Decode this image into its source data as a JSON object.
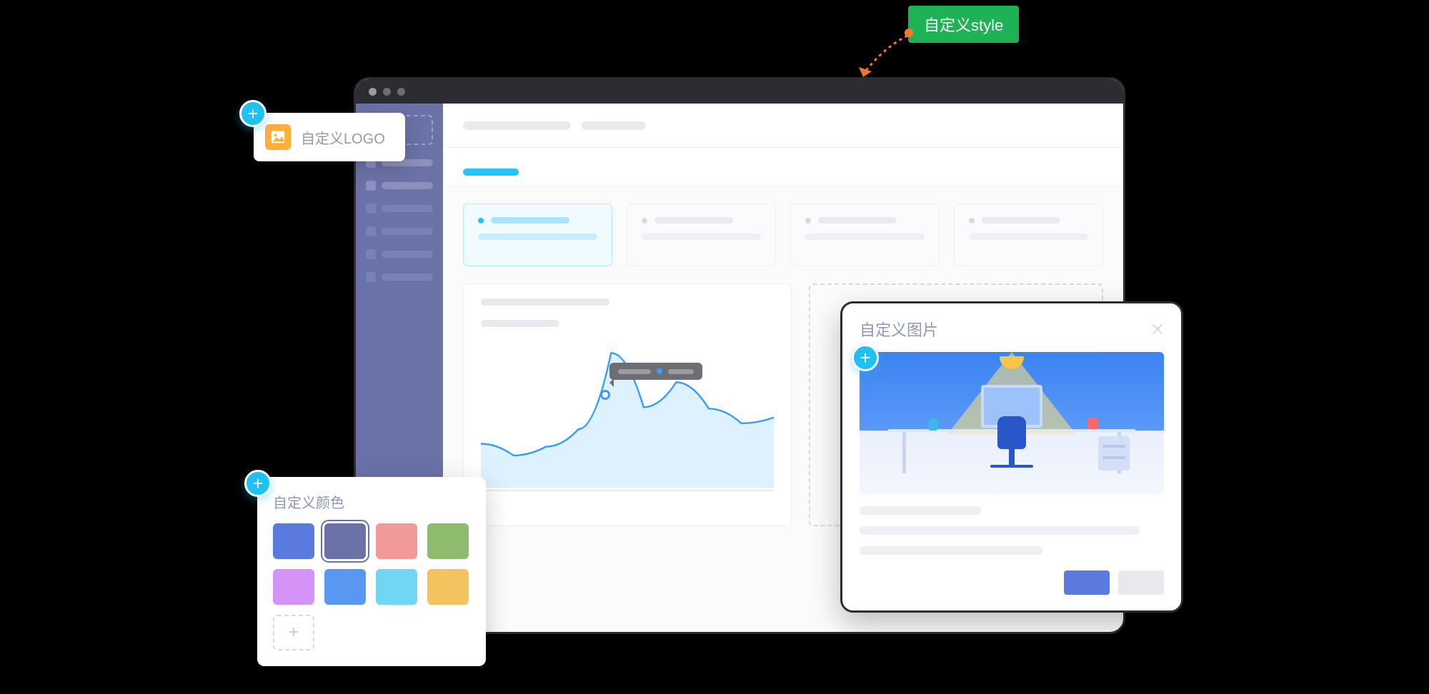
{
  "callouts": {
    "style_label": "自定义style",
    "logo_label": "自定义LOGO",
    "color_title": "自定义颜色",
    "image_title": "自定义图片"
  },
  "color_palette": {
    "swatches": [
      {
        "hex": "#5a7ae0",
        "selected": false
      },
      {
        "hex": "#6b72a7",
        "selected": true
      },
      {
        "hex": "#f19a9a",
        "selected": false
      },
      {
        "hex": "#8fbb6f",
        "selected": false
      },
      {
        "hex": "#d693f7",
        "selected": false
      },
      {
        "hex": "#5a97f2",
        "selected": false
      },
      {
        "hex": "#6fd6f4",
        "selected": false
      },
      {
        "hex": "#f2c35e",
        "selected": false
      }
    ]
  },
  "chart_data": {
    "type": "line",
    "x": [
      0,
      1,
      2,
      3,
      4,
      5,
      6,
      7,
      8,
      9
    ],
    "values": [
      30,
      22,
      28,
      40,
      92,
      55,
      72,
      54,
      44,
      48
    ],
    "ylim": [
      0,
      100
    ],
    "highlight_index": 4,
    "stroke": "#3a9df8",
    "fill": "#d9effe"
  }
}
